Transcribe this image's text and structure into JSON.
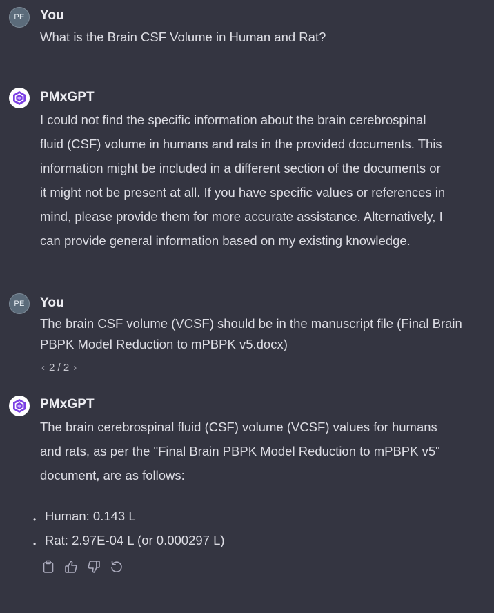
{
  "messages": [
    {
      "role": "user",
      "avatar": "PE",
      "author": "You",
      "text": "What is the Brain CSF Volume in Human and Rat?"
    },
    {
      "role": "assistant",
      "author": "PMxGPT",
      "lines": [
        "I could not find the specific information about the brain cerebrospinal",
        "fluid (CSF) volume in humans and rats in the provided documents. This",
        "information might be included in a different section of the documents or",
        "it might not be present at all. If you have specific values or references in",
        "mind, please provide them for more accurate assistance. Alternatively, I",
        "can provide general information based on my existing knowledge."
      ]
    },
    {
      "role": "user",
      "avatar": "PE",
      "author": "You",
      "lines": [
        "The brain CSF volume (VCSF) should be in the manuscript file (Final Brain",
        "PBPK Model Reduction to mPBPK v5.docx)"
      ],
      "pager": "2 / 2"
    },
    {
      "role": "assistant",
      "author": "PMxGPT",
      "lines": [
        "The brain cerebrospinal fluid (CSF) volume (VCSF) values for humans",
        "and rats, as per the \"Final Brain PBPK Model Reduction to mPBPK v5\"",
        "document, are as follows:"
      ],
      "bullets": [
        "Human: 0.143 L",
        "Rat: 2.97E-04 L (or 0.000297 L)"
      ],
      "actions": [
        "copy-icon",
        "thumbs-up-icon",
        "thumbs-down-icon",
        "regenerate-icon"
      ]
    }
  ],
  "colors": {
    "background": "#343541",
    "text": "#ececf1",
    "user_avatar": "#5b6b7a",
    "bot_logo_purple": "#7b3fe4"
  }
}
